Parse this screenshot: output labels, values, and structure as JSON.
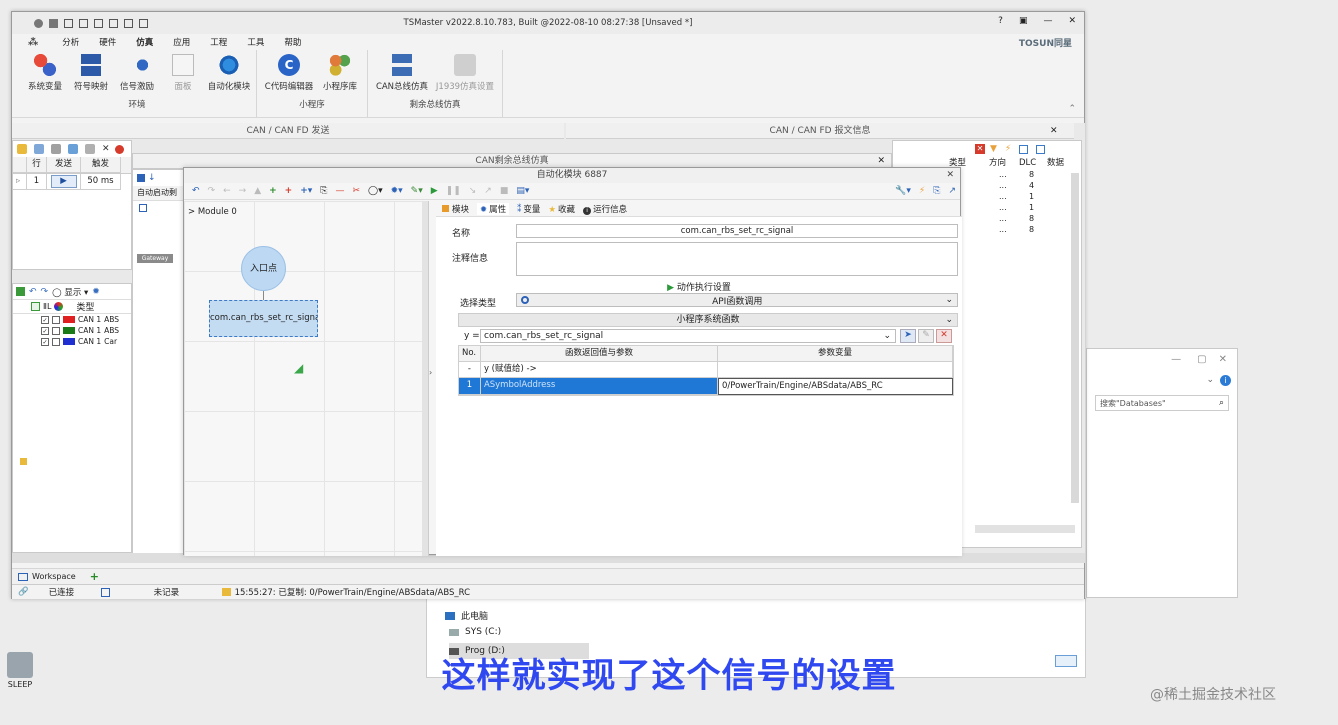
{
  "window": {
    "title": "TSMaster v2022.8.10.783, Built @2022-08-10 08:27:38 [Unsaved *]",
    "brand": "TOSUN同星",
    "controls": [
      "?",
      "▣",
      "—",
      "✕"
    ]
  },
  "menu": [
    "分析",
    "硬件",
    "仿真",
    "应用",
    "工程",
    "工具",
    "帮助"
  ],
  "ribbon": {
    "groups": [
      {
        "label": "环境",
        "buttons": [
          "系统变量",
          "符号映射",
          "信号激励",
          "面板",
          "自动化模块"
        ]
      },
      {
        "label": "小程序",
        "buttons": [
          "C代码编辑器",
          "小程序库"
        ]
      },
      {
        "label": "剩余总线仿真",
        "buttons": [
          "CAN总线仿真",
          "J1939仿真设置"
        ]
      }
    ]
  },
  "panels": {
    "can_send_title": "CAN / CAN FD 发送",
    "can_report_title": "CAN / CAN FD 报文信息",
    "rbs_title": "CAN剩余总线仿真",
    "send_table": {
      "headers": [
        "行",
        "发送",
        "触发"
      ],
      "row": [
        "1",
        "▶",
        "50 ms"
      ]
    },
    "report_table": {
      "headers": [
        "类型",
        "方向",
        "DLC",
        "数据"
      ],
      "rows": [
        [
          "...",
          "8"
        ],
        [
          "...",
          "4"
        ],
        [
          "...",
          "1"
        ],
        [
          "...",
          "1"
        ],
        [
          "...",
          "8"
        ],
        [
          "...",
          "8"
        ]
      ]
    },
    "rbs_tab": "自动启动剩",
    "gateway_label": "Gateway",
    "channel_list": {
      "show_label": "显示",
      "type_header": "类型",
      "rows": [
        {
          "color": "#e02020",
          "channel": "CAN 1",
          "tail": "ABS"
        },
        {
          "color": "#1a7a1a",
          "channel": "CAN 1",
          "tail": "ABS"
        },
        {
          "color": "#1f2fd0",
          "channel": "CAN 1",
          "tail": "Car"
        }
      ]
    }
  },
  "automation": {
    "title": "自动化模块 6887",
    "module_label": "> Module 0",
    "entry_node": "入口点",
    "func_node": "com.can_rbs_set_rc_signal",
    "tabs": [
      "模块",
      "属性",
      "变量",
      "收藏",
      "运行信息"
    ],
    "name_label": "名称",
    "name_value": "com.can_rbs_set_rc_signal",
    "comment_label": "注释信息",
    "action_label": "动作执行设置",
    "select_type_label": "选择类型",
    "select_type_value": "API函数调用",
    "subtitle": "小程序系统函数",
    "y_label": "y =",
    "y_value": "com.can_rbs_set_rc_signal",
    "param_headers": [
      "No.",
      "函数返回值与参数",
      "参数变量"
    ],
    "param_rows": [
      {
        "no": "-",
        "name": "y (赋值给) ->",
        "value": ""
      },
      {
        "no": "1",
        "name": "ASymbolAddress",
        "value": "0/PowerTrain/Engine/ABSdata/ABS_RC"
      }
    ]
  },
  "statusbar": {
    "workspace": "Workspace",
    "connected": "已连接",
    "record": "未记录",
    "message": "15:55:27: 已复制: 0/PowerTrain/Engine/ABSdata/ABS_RC"
  },
  "explorer": {
    "search_placeholder": "搜索\"Databases\"",
    "items": [
      "此电脑",
      "SYS (C:)",
      "Prog (D:)"
    ]
  },
  "desktop": {
    "sleep_label": "SLEEP"
  },
  "caption": "这样就实现了这个信号的设置",
  "watermark": "@稀土掘金技术社区",
  "colors": {
    "accent": "#2b7bd6",
    "caption": "#2f48f0",
    "titlebar": "#ececec"
  }
}
